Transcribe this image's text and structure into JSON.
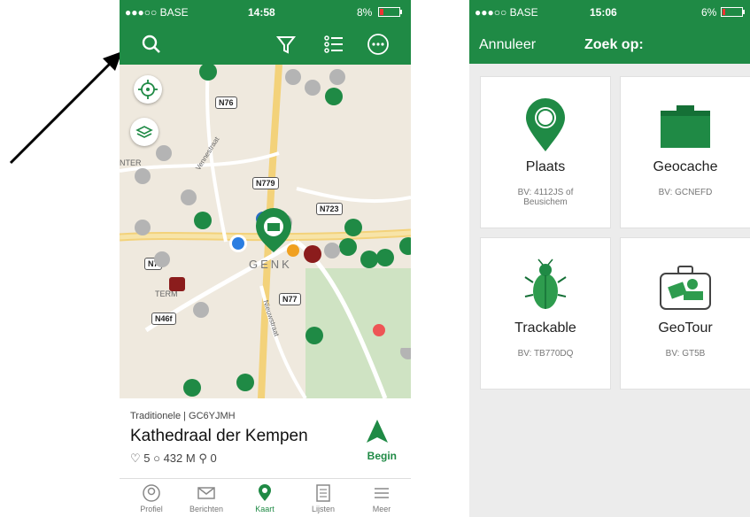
{
  "phone1": {
    "status": {
      "carrier": "●●●○○ BASE",
      "time": "14:58",
      "battery": "8%"
    },
    "map": {
      "roads": [
        "N76",
        "N779",
        "N723",
        "N77",
        "N46f",
        "N7"
      ],
      "places": [
        "GENK",
        "TERM",
        "NTER",
        "Vennestraat",
        "Nieuwstraat"
      ]
    },
    "card": {
      "type": "Traditionele | GC6YJMH",
      "name": "Kathedraal der Kempen",
      "stats": "♡ 5   ○ 432 M   ⚲ 0",
      "begin": "Begin"
    },
    "tabs": [
      "Profiel",
      "Berichten",
      "Kaart",
      "Lijsten",
      "Meer"
    ]
  },
  "phone2": {
    "status": {
      "carrier": "●●●○○ BASE",
      "time": "15:06",
      "battery": "6%"
    },
    "header": {
      "cancel": "Annuleer",
      "title": "Zoek op:"
    },
    "tiles": [
      {
        "label": "Plaats",
        "sub": "BV: 4112JS of Beusichem"
      },
      {
        "label": "Geocache",
        "sub": "BV: GCNEFD"
      },
      {
        "label": "Trackable",
        "sub": "BV: TB770DQ"
      },
      {
        "label": "GeoTour",
        "sub": "BV: GT5B"
      }
    ]
  },
  "colors": {
    "brand_green": "#1f8a45",
    "map_bg": "#efe9de",
    "marker_red": "#8b1c1c"
  }
}
